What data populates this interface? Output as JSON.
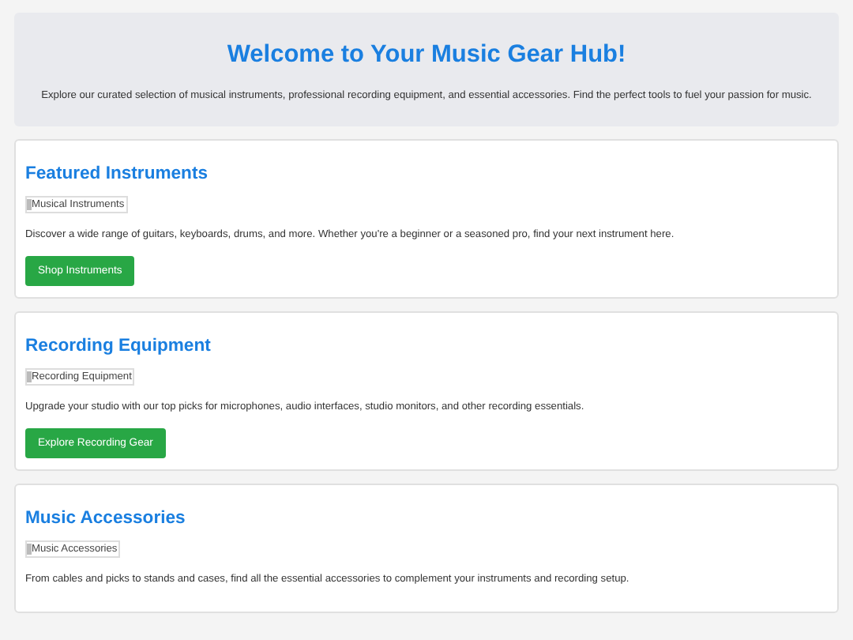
{
  "hero": {
    "title": "Welcome to Your Music Gear Hub!",
    "text": "Explore our curated selection of musical instruments, professional recording equipment, and essential accessories. Find the perfect tools to fuel your passion for music."
  },
  "sections": [
    {
      "heading": "Featured Instruments",
      "image_alt": "Musical Instruments",
      "text": "Discover a wide range of guitars, keyboards, drums, and more. Whether you're a beginner or a seasoned pro, find your next instrument here.",
      "button": "Shop Instruments"
    },
    {
      "heading": "Recording Equipment",
      "image_alt": "Recording Equipment",
      "text": "Upgrade your studio with our top picks for microphones, audio interfaces, studio monitors, and other recording essentials.",
      "button": "Explore Recording Gear"
    },
    {
      "heading": "Music Accessories",
      "image_alt": "Music Accessories",
      "text": "From cables and picks to stands and cases, find all the essential accessories to complement your instruments and recording setup."
    }
  ]
}
